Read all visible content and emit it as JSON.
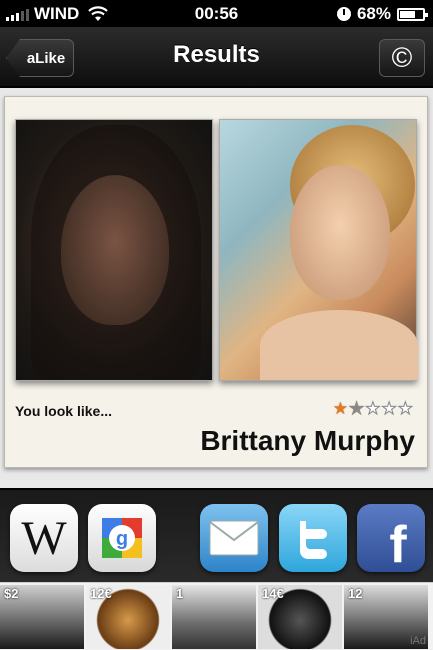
{
  "status": {
    "carrier": "WIND",
    "time": "00:56",
    "battery": "68%",
    "battery_level": 0.68
  },
  "nav": {
    "back_label": "aLike",
    "title": "Results",
    "right_icon": "copyright-icon"
  },
  "result": {
    "lookalike_label": "You look like...",
    "celebrity_name": "Brittany Murphy",
    "rating": 1.5,
    "rating_max": 5
  },
  "share": [
    "wikipedia-icon",
    "google-icon",
    "mail-icon",
    "twitter-icon",
    "facebook-icon"
  ],
  "ads": {
    "prices": [
      "$2",
      "12€",
      "1",
      "14€",
      "12"
    ],
    "badge": "iAd"
  }
}
